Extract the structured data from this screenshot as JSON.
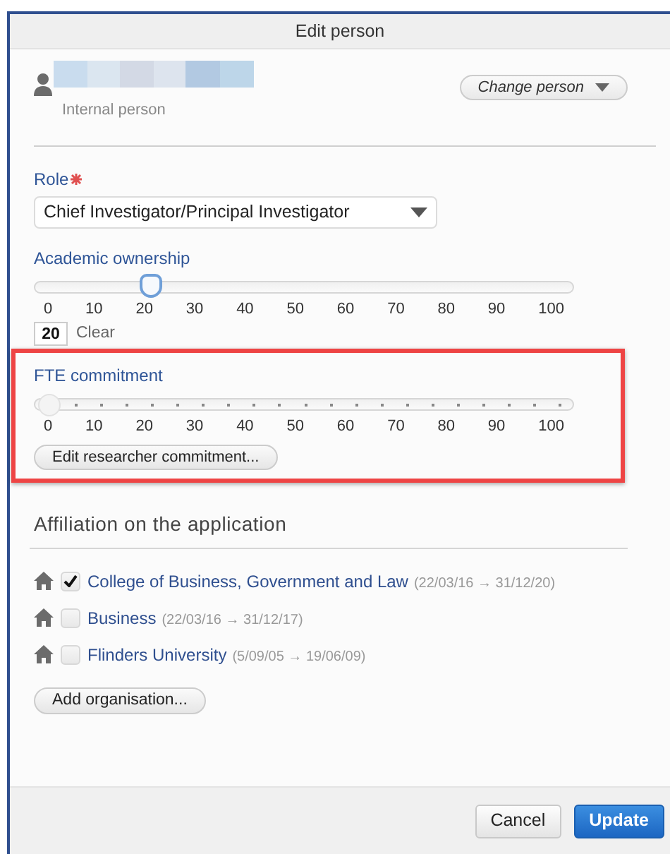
{
  "dialog": {
    "title": "Edit person"
  },
  "person": {
    "subtitle": "Internal person",
    "change_button": "Change person"
  },
  "role": {
    "label": "Role",
    "required": true,
    "value": "Chief Investigator/Principal Investigator"
  },
  "sliders": [
    {
      "kind": "plain",
      "label": "Academic ownership",
      "level": 0.2,
      "scale": [
        "0",
        "10",
        "20",
        "30",
        "40",
        "50",
        "60",
        "70",
        "80",
        "90",
        "100"
      ],
      "value_field": "20",
      "clear_link": "Clear"
    },
    {
      "kind": "stepped",
      "label": "FTE commitment",
      "level": 0,
      "scale": [
        "0",
        "10",
        "20",
        "30",
        "40",
        "50",
        "60",
        "70",
        "80",
        "90",
        "100"
      ],
      "button": "Edit researcher commitment..."
    }
  ],
  "affiliation": {
    "heading": "Affiliation on the application",
    "organisations": [
      {
        "name": "College of Business, Government and Law",
        "dates": "(22/03/16 → 31/12/20)",
        "checked": true
      },
      {
        "name": "Business",
        "dates": "(22/03/16 → 31/12/17)",
        "checked": false
      },
      {
        "name": "Flinders University",
        "dates": "(5/09/05 → 19/06/09)",
        "checked": false
      }
    ],
    "add_button": "Add organisation..."
  },
  "footer": {
    "buttons": [
      {
        "label": "Cancel",
        "kind": "secondary"
      },
      {
        "label": "Update",
        "kind": "primary"
      }
    ]
  }
}
